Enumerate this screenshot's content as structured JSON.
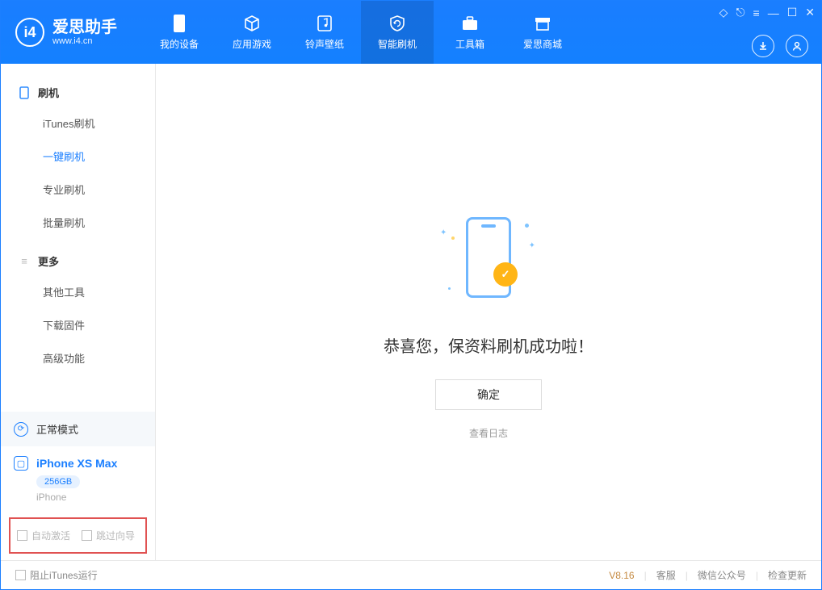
{
  "app": {
    "title": "爱思助手",
    "subtitle": "www.i4.cn"
  },
  "nav": {
    "items": [
      {
        "label": "我的设备"
      },
      {
        "label": "应用游戏"
      },
      {
        "label": "铃声壁纸"
      },
      {
        "label": "智能刷机"
      },
      {
        "label": "工具箱"
      },
      {
        "label": "爱思商城"
      }
    ]
  },
  "sidebar": {
    "section_flash": "刷机",
    "items_flash": [
      {
        "label": "iTunes刷机"
      },
      {
        "label": "一键刷机"
      },
      {
        "label": "专业刷机"
      },
      {
        "label": "批量刷机"
      }
    ],
    "section_more": "更多",
    "items_more": [
      {
        "label": "其他工具"
      },
      {
        "label": "下载固件"
      },
      {
        "label": "高级功能"
      }
    ],
    "status": "正常模式",
    "device": {
      "name": "iPhone XS Max",
      "capacity": "256GB",
      "type": "iPhone"
    },
    "options": {
      "auto_activate": "自动激活",
      "skip_guide": "跳过向导"
    }
  },
  "main": {
    "success_message": "恭喜您，保资料刷机成功啦！",
    "confirm_button": "确定",
    "view_log": "查看日志"
  },
  "footer": {
    "block_itunes": "阻止iTunes运行",
    "version": "V8.16",
    "links": {
      "support": "客服",
      "wechat": "微信公众号",
      "update": "检查更新"
    }
  }
}
